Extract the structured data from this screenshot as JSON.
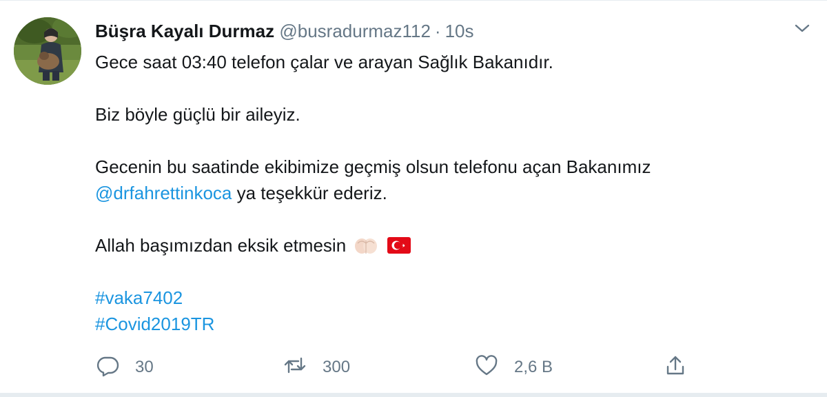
{
  "tweet": {
    "display_name": "Büşra Kayalı Durmaz",
    "handle": "@busradurmaz112",
    "separator": "·",
    "time": "10s",
    "body": {
      "line1": "Gece saat 03:40 telefon çalar ve arayan Sağlık Bakanıdır.",
      "line2": "Biz böyle güçlü bir aileyiz.",
      "line3": "Gecenin bu saatinde ekibimize  geçmiş olsun telefonu açan Bakanımız",
      "mention": "@drfahrettinkoca",
      "line4_rest": " ya teşekkür ederiz.",
      "line5": "Allah başımızdan eksik etmesin",
      "hashtag1": "#vaka7402",
      "hashtag2": "#Covid2019TR"
    },
    "actions": {
      "reply_count": "30",
      "retweet_count": "300",
      "like_count": "2,6 B"
    }
  },
  "colors": {
    "text": "#14171a",
    "secondary": "#657786",
    "link": "#1b95e0",
    "flag_red": "#e30a17"
  },
  "icons": [
    "caret-down-icon",
    "folded-hands-emoji",
    "turkey-flag-emoji",
    "reply-icon",
    "retweet-icon",
    "like-icon",
    "share-icon"
  ]
}
